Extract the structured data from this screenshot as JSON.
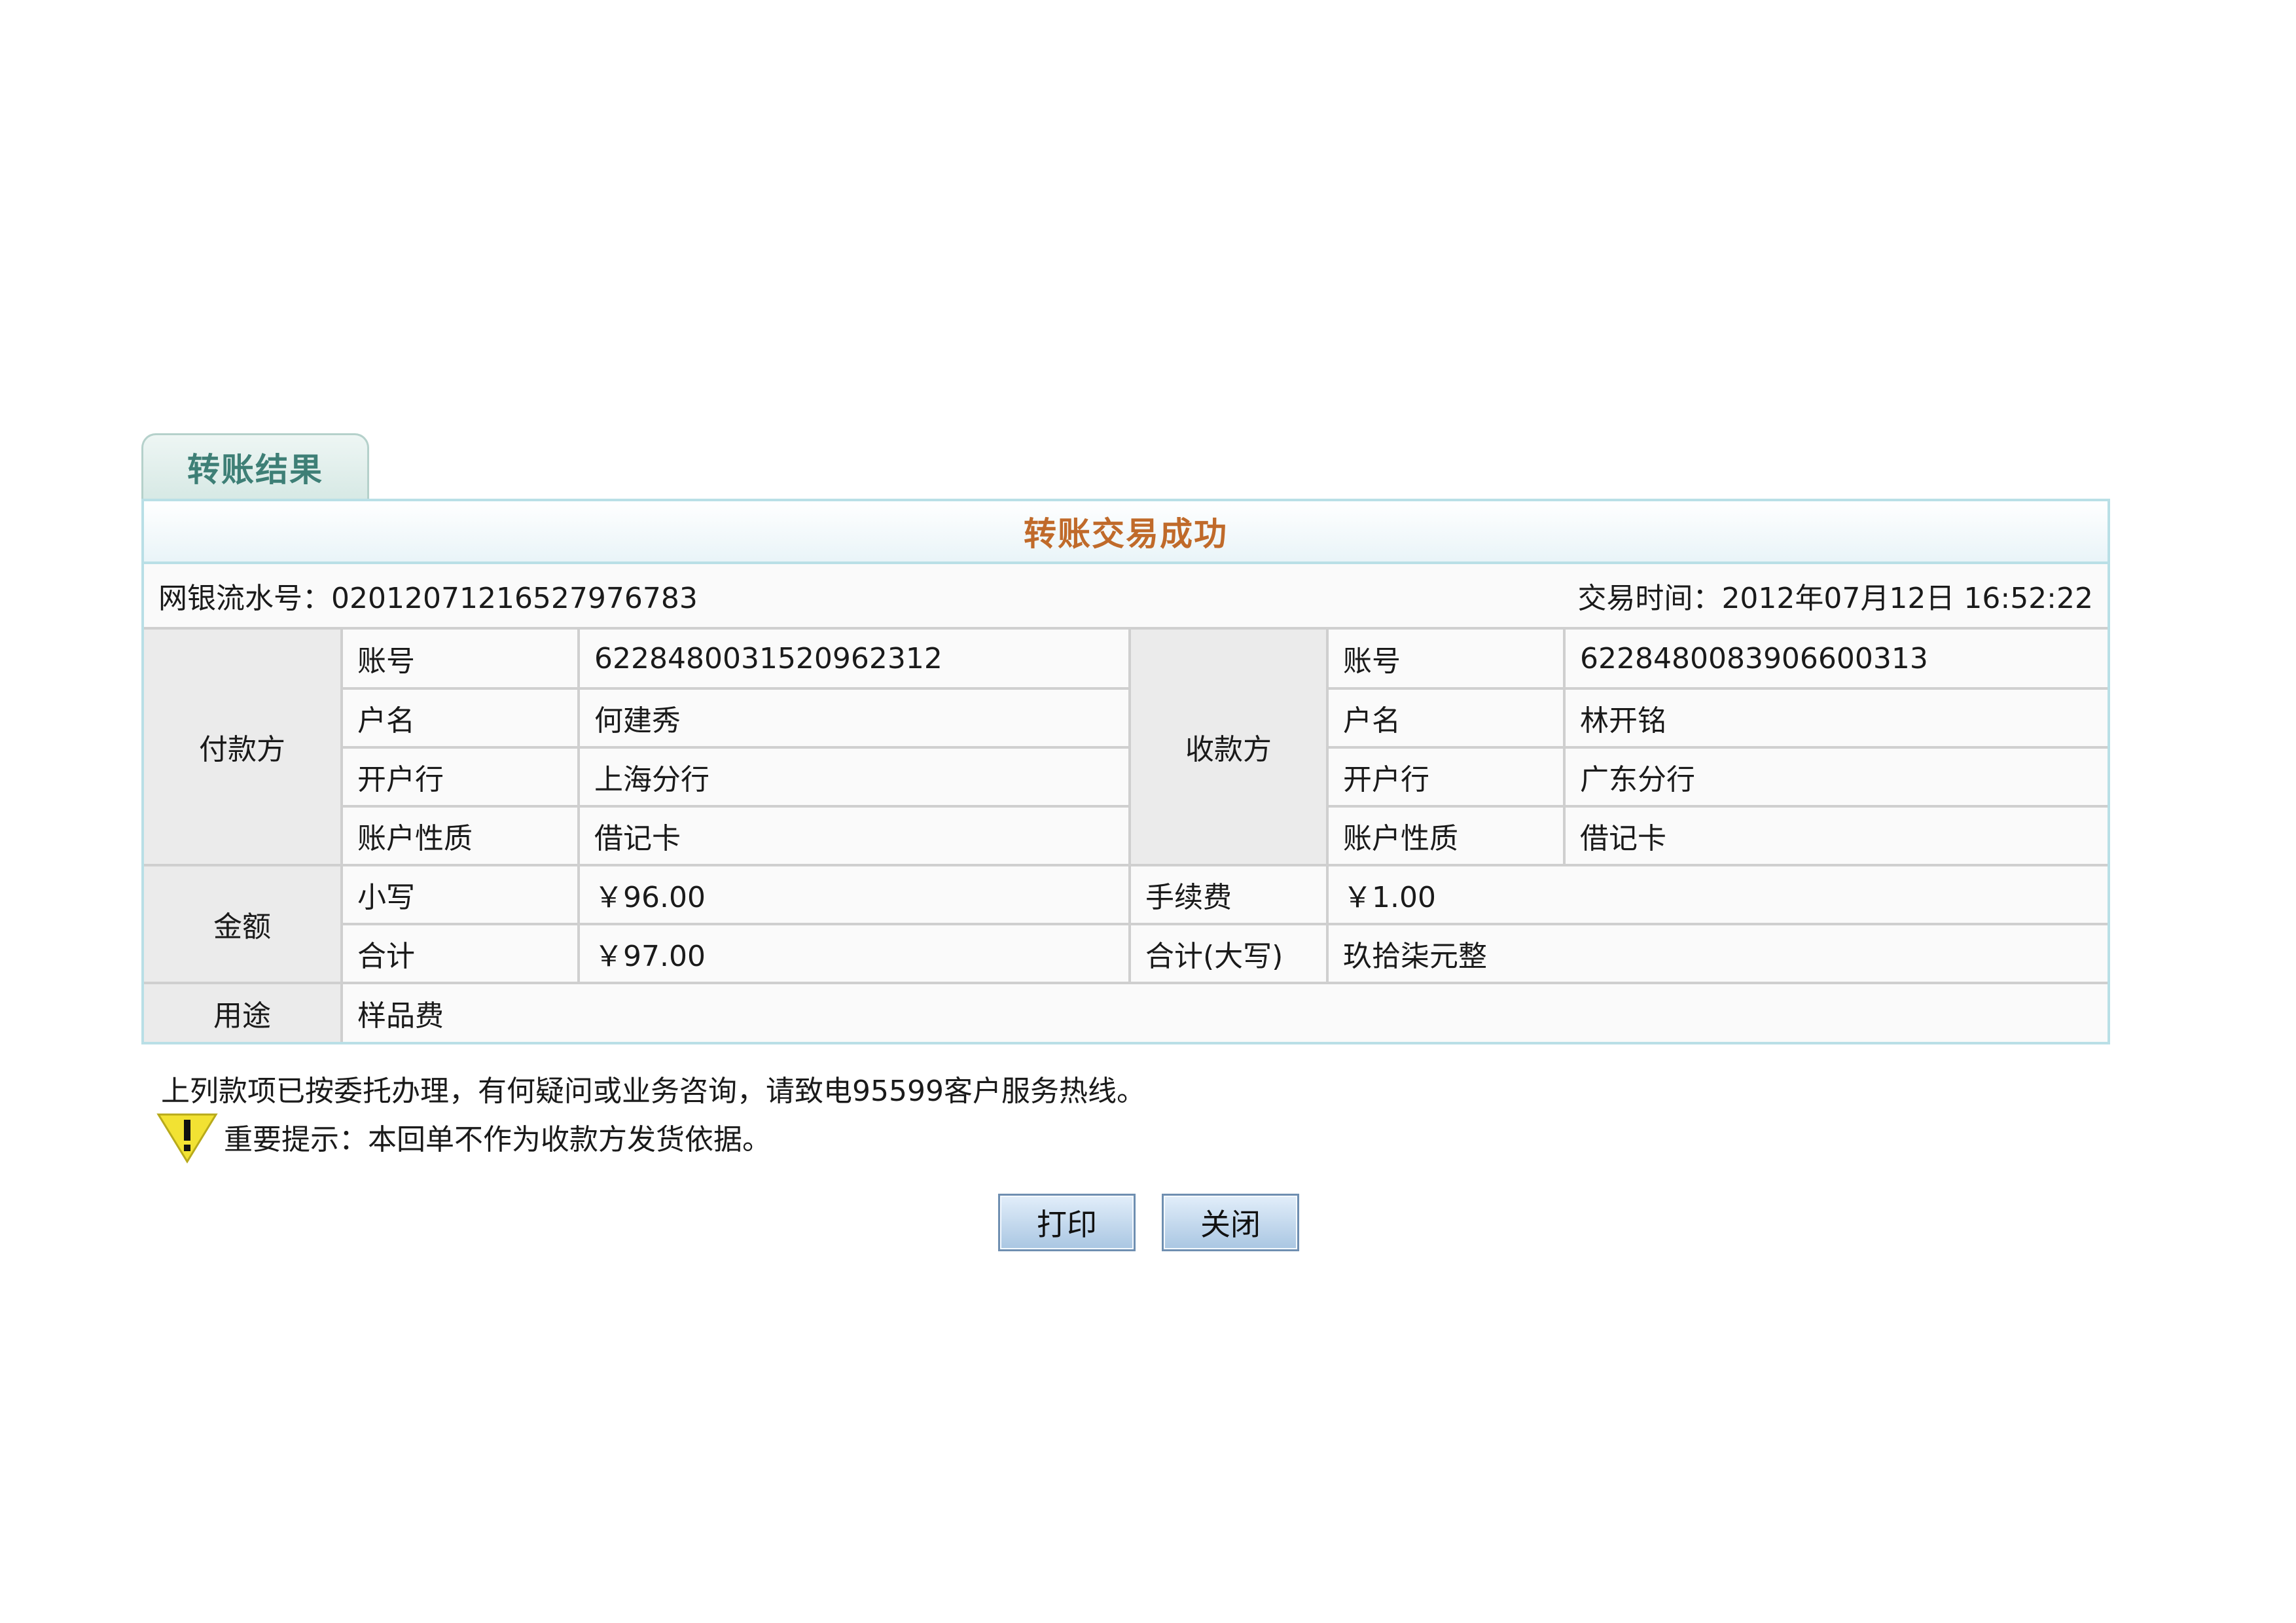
{
  "tab": {
    "label": "转账结果"
  },
  "headline": "转账交易成功",
  "meta": {
    "serial_label": "网银流水号：",
    "serial_value": "02012071216527976783",
    "time_label": "交易时间：",
    "time_value": "2012年07月12日 16:52:22"
  },
  "payer": {
    "group_label": "付款方",
    "rows": [
      {
        "label": "账号",
        "value": "6228480031520962312"
      },
      {
        "label": "户名",
        "value": "何建秀"
      },
      {
        "label": "开户行",
        "value": "上海分行"
      },
      {
        "label": "账户性质",
        "value": "借记卡"
      }
    ]
  },
  "payee": {
    "group_label": "收款方",
    "rows": [
      {
        "label": "账号",
        "value": "6228480083906600313"
      },
      {
        "label": "户名",
        "value": "林开铭"
      },
      {
        "label": "开户行",
        "value": "广东分行"
      },
      {
        "label": "账户性质",
        "value": "借记卡"
      }
    ]
  },
  "amount": {
    "group_label": "金额",
    "small_label": "小写",
    "small_value": "￥96.00",
    "fee_label": "手续费",
    "fee_value": "￥1.00",
    "total_label": "合计",
    "total_value": "￥97.00",
    "total_upper_label": "合计(大写)",
    "total_upper_value": "玖拾柒元整"
  },
  "purpose": {
    "label": "用途",
    "value": "样品费"
  },
  "notes": {
    "line1": "上列款项已按委托办理，有何疑问或业务咨询，请致电95599客户服务热线。",
    "warning": "重要提示：本回单不作为收款方发货依据。",
    "warning_icon": "warning-icon"
  },
  "buttons": {
    "print": "打印",
    "close": "关闭"
  },
  "colors": {
    "headline": "#c06a2a",
    "tab_text": "#3e7f76",
    "frame_border": "#b9dfe6",
    "cell_border": "#cfcfcf",
    "group_bg": "#ebebeb",
    "warning": "#f2e233"
  }
}
